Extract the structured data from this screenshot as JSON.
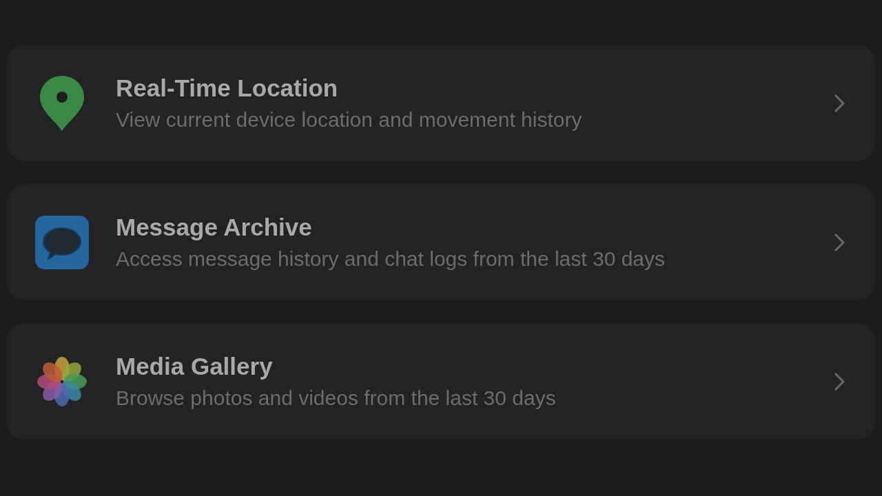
{
  "items": [
    {
      "kind": "location",
      "title": "Real-Time Location",
      "subtitle": "View current device location and movement history"
    },
    {
      "kind": "messages",
      "title": "Message Archive",
      "subtitle": "Access message history and chat logs from the last 30 days"
    },
    {
      "kind": "gallery",
      "title": "Media Gallery",
      "subtitle": "Browse photos and videos from the last 30 days"
    }
  ]
}
